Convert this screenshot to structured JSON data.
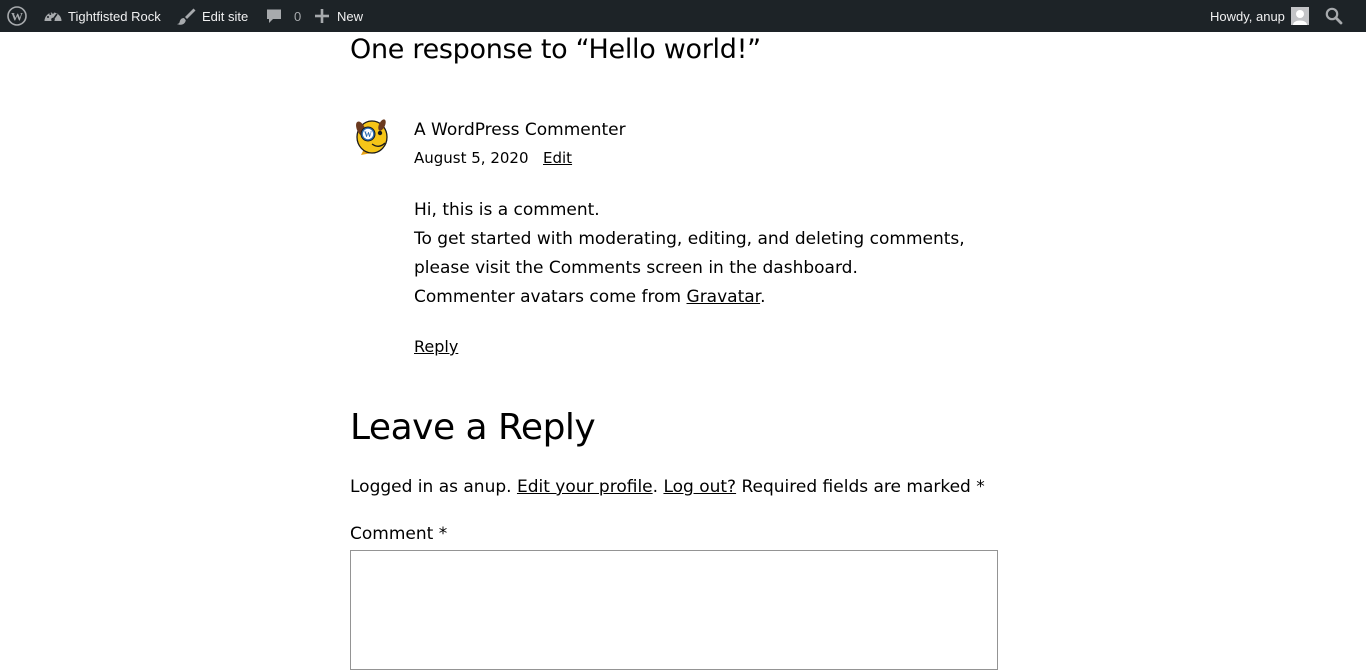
{
  "adminbar": {
    "site_name": "Tightfisted Rock",
    "edit_site": "Edit site",
    "comments_count": "0",
    "new_label": "New",
    "greeting": "Howdy, anup"
  },
  "comments": {
    "title": "One response to “Hello world!”",
    "items": [
      {
        "author": "A WordPress Commenter",
        "date": "August 5, 2020",
        "edit_label": "Edit",
        "line1": "Hi, this is a comment.",
        "line2": "To get started with moderating, editing, and deleting comments, please visit the Comments screen in the dashboard.",
        "line3_prefix": "Commenter avatars come from ",
        "line3_link": "Gravatar",
        "line3_suffix": ".",
        "reply_label": "Reply"
      }
    ]
  },
  "reply_form": {
    "title": "Leave a Reply",
    "logged_in_prefix": "Logged in as anup. ",
    "edit_profile": "Edit your profile",
    "separator": ". ",
    "log_out": "Log out?",
    "required_note": " Required fields are marked *",
    "comment_label": "Comment *",
    "comment_value": ""
  },
  "colors": {
    "adminbar_bg": "#1d2327",
    "adminbar_text": "#f0f0f1",
    "text": "#000000"
  }
}
